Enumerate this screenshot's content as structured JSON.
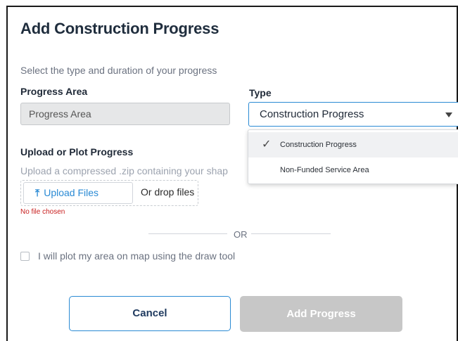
{
  "modal": {
    "title": "Add Construction Progress",
    "subtitle": "Select the type and duration of your progress"
  },
  "progress_area": {
    "label": "Progress Area",
    "value": "Progress Area"
  },
  "type": {
    "label": "Type",
    "selected": "Construction Progress",
    "options": [
      {
        "label": "Construction Progress",
        "selected": true
      },
      {
        "label": "Non-Funded Service Area",
        "selected": false
      }
    ]
  },
  "upload": {
    "label": "Upload or Plot Progress",
    "hint": "Upload a compressed .zip containing your shap",
    "button_label": "Upload Files",
    "drop_text": "Or drop files",
    "no_file_text": "No file chosen"
  },
  "divider": {
    "text": "OR"
  },
  "plot_option": {
    "label": "I will plot my area on map using the draw tool",
    "checked": false
  },
  "actions": {
    "cancel_label": "Cancel",
    "add_label": "Add Progress"
  },
  "colors": {
    "accent": "#2a8ad4",
    "error": "#c81e1e",
    "disabled": "#c7c7c7"
  },
  "icons": {
    "upload": "upload-icon",
    "check": "check-icon",
    "caret": "caret-down-icon"
  }
}
